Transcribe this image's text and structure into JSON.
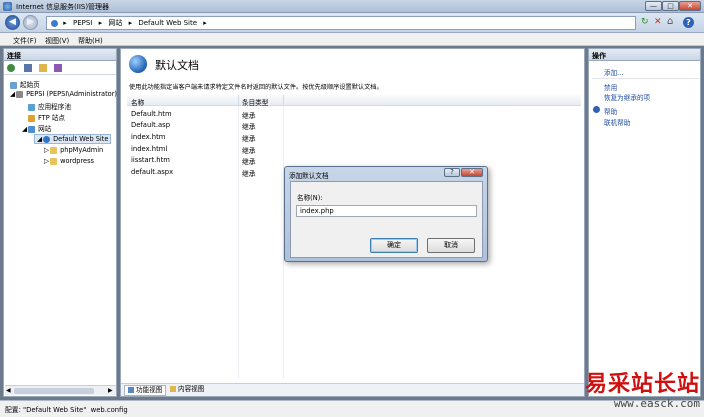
{
  "window": {
    "title": "Internet 信息服务(IIS)管理器",
    "min": "—",
    "max": "□",
    "close": "✕"
  },
  "nav": {
    "back": "◀",
    "forward": "▶",
    "breadcrumb": [
      "PEPSI",
      "网站",
      "Default Web Site"
    ],
    "sep": "▸",
    "refresh": "↻",
    "stop": "✕",
    "home": "⌂",
    "help": "?"
  },
  "menu": {
    "file": "文件(F)",
    "view": "视图(V)",
    "help": "帮助(H)"
  },
  "left": {
    "header": "连接",
    "tree": [
      "起始页",
      "PEPSI (PEPSI\\Administrator)",
      "应用程序池",
      "FTP 站点",
      "网站",
      "Default Web Site",
      "phpMyAdmin",
      "wordpress"
    ]
  },
  "main": {
    "title": "默认文档",
    "description": "使用此功能指定当客户端未请求特定文件名时返回的默认文件。按优先级顺序设置默认文档。",
    "columns": [
      "名称",
      "条目类型"
    ],
    "rows": [
      {
        "name": "Default.htm",
        "type": "继承"
      },
      {
        "name": "Default.asp",
        "type": "继承"
      },
      {
        "name": "index.htm",
        "type": "继承"
      },
      {
        "name": "index.html",
        "type": "继承"
      },
      {
        "name": "iisstart.htm",
        "type": "继承"
      },
      {
        "name": "default.aspx",
        "type": "继承"
      }
    ],
    "tab_feature": "功能视图",
    "tab_content": "内容视图"
  },
  "actions": {
    "header": "操作",
    "add": "添加...",
    "disable": "禁用",
    "revert": "恢复为继承的项",
    "help": "帮助",
    "online_help": "联机帮助"
  },
  "dialog": {
    "title": "添加默认文档",
    "help": "?",
    "close": "✕",
    "name_label": "名称(N):",
    "name_value": "index.php",
    "ok": "确定",
    "cancel": "取消"
  },
  "status": {
    "text": "配置: \"Default Web Site\"  web.config"
  },
  "watermark": {
    "text": "易采站长站",
    "url": "www.easck.com"
  },
  "colors": {
    "accent": "#1f4ea3",
    "watermark": "#d01010"
  }
}
